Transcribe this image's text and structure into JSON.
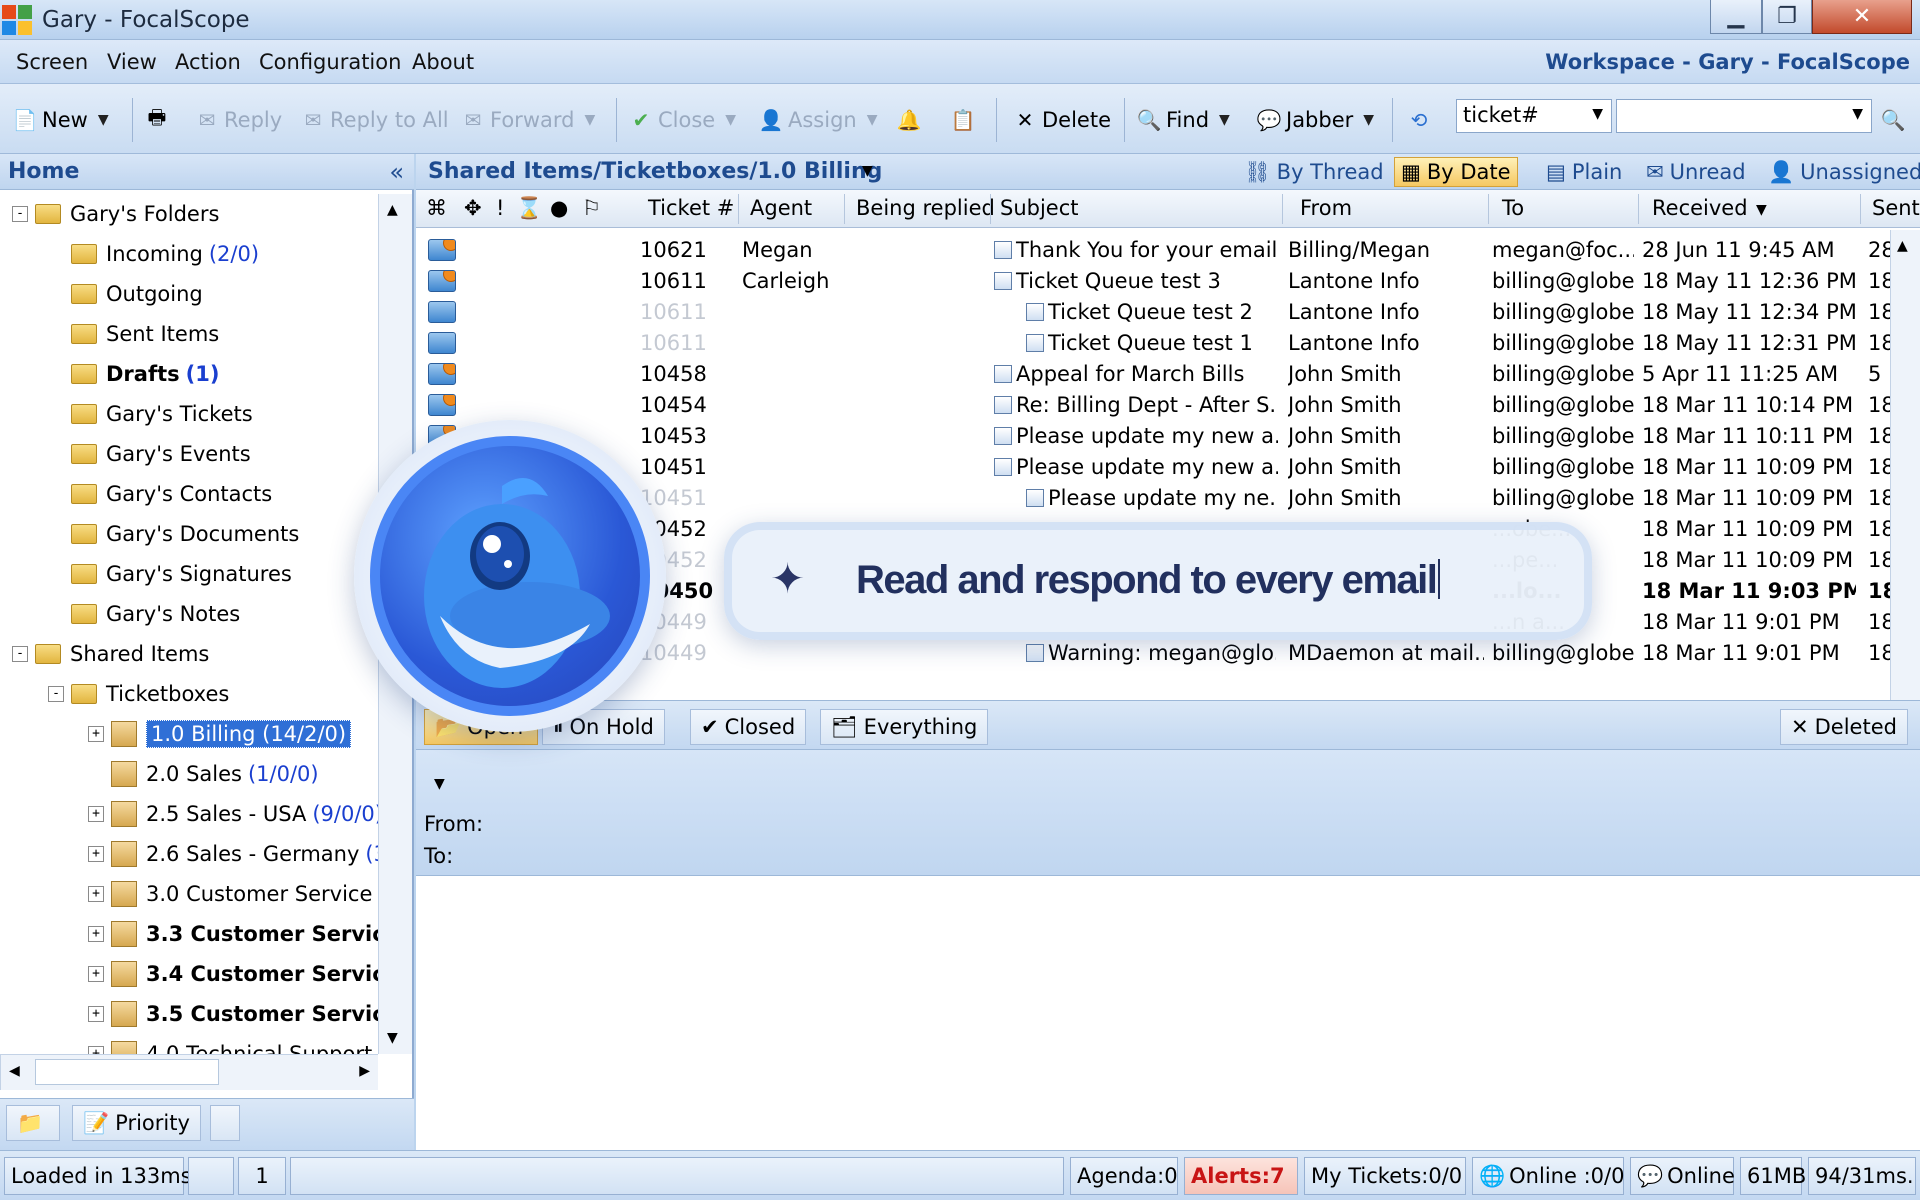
{
  "window": {
    "title": "Gary - FocalScope"
  },
  "menu": {
    "items": [
      "Screen",
      "View",
      "Action",
      "Configuration",
      "About"
    ],
    "workspace_title": "Workspace - Gary - FocalScope"
  },
  "toolbar": {
    "new": "New",
    "reply": "Reply",
    "reply_all": "Reply to All",
    "forward": "Forward",
    "close": "Close",
    "assign": "Assign",
    "delete": "Delete",
    "find": "Find",
    "jabber": "Jabber",
    "search_field": "ticket#",
    "search_value": ""
  },
  "left": {
    "header": "Home",
    "tree": [
      {
        "label": "Gary's Folders",
        "level": 0,
        "expander": "-"
      },
      {
        "label": "Incoming",
        "count": "(2/0)",
        "level": 1
      },
      {
        "label": "Outgoing",
        "level": 1
      },
      {
        "label": "Sent Items",
        "level": 1
      },
      {
        "label": "Drafts",
        "count": "(1)",
        "level": 1,
        "bold": true
      },
      {
        "label": "Gary's Tickets",
        "level": 1
      },
      {
        "label": "Gary's Events",
        "level": 1
      },
      {
        "label": "Gary's Contacts",
        "level": 1
      },
      {
        "label": "Gary's Documents",
        "level": 1
      },
      {
        "label": "Gary's Signatures",
        "level": 1
      },
      {
        "label": "Gary's Notes",
        "level": 1
      },
      {
        "label": "Shared Items",
        "level": 0,
        "expander": "-"
      },
      {
        "label": "Ticketboxes",
        "level": 1,
        "expander": "-"
      },
      {
        "label": "1.0 Billing (14/2/0)",
        "level": 2,
        "expander": "+",
        "selected": true
      },
      {
        "label": "2.0 Sales",
        "count": "(1/0/0)",
        "level": 2
      },
      {
        "label": "2.5 Sales - USA",
        "count": "(9/0/0)",
        "level": 2,
        "expander": "+"
      },
      {
        "label": "2.6 Sales - Germany",
        "count": "(3",
        "level": 2,
        "expander": "+"
      },
      {
        "label": "3.0 Customer Service",
        "level": 2,
        "expander": "+"
      },
      {
        "label": "3.3 Customer Servic",
        "level": 2,
        "expander": "+",
        "bold": true
      },
      {
        "label": "3.4 Customer Servic",
        "level": 2,
        "expander": "+",
        "bold": true
      },
      {
        "label": "3.5 Customer Servic",
        "level": 2,
        "expander": "+",
        "bold": true
      },
      {
        "label": "4.0 Technical Support",
        "level": 2,
        "expander": "+"
      }
    ],
    "bottom_tab": "Priority"
  },
  "grid": {
    "path": "Shared Items/Ticketboxes/1.0 Billing",
    "views": [
      "By Thread",
      "By Date",
      "Plain",
      "Unread",
      "Unassigned"
    ],
    "active_view": "By Date",
    "columns": [
      "Ticket #",
      "Agent",
      "Being replied",
      "Subject",
      "From",
      "To",
      "Received",
      "Sent"
    ],
    "rows": [
      {
        "ticket": "10621",
        "agent": "Megan",
        "subject": "Thank You for your email...",
        "from": "Billing/Megan",
        "to": "megan@foc...",
        "received": "28 Jun 11 9:45 AM",
        "sent": "28",
        "dim": false,
        "indent": false,
        "thread": false,
        "icon": "flag"
      },
      {
        "ticket": "10611",
        "agent": "Carleigh",
        "subject": "Ticket Queue test 3",
        "from": "Lantone Info",
        "to": "billing@globe...",
        "received": "18 May 11 12:36 PM",
        "sent": "18",
        "dim": false,
        "indent": false,
        "thread": true,
        "icon": "flag"
      },
      {
        "ticket": "10611",
        "agent": "",
        "subject": "Ticket Queue test 2",
        "from": "Lantone Info",
        "to": "billing@globe...",
        "received": "18 May 11 12:34 PM",
        "sent": "18",
        "dim": true,
        "indent": true,
        "thread": false,
        "icon": "plain"
      },
      {
        "ticket": "10611",
        "agent": "",
        "subject": "Ticket Queue test 1",
        "from": "Lantone Info",
        "to": "billing@globe...",
        "received": "18 May 11 12:31 PM",
        "sent": "18",
        "dim": true,
        "indent": true,
        "thread": false,
        "icon": "plain"
      },
      {
        "ticket": "10458",
        "agent": "",
        "subject": "Appeal for March Bills",
        "from": "John Smith",
        "to": "billing@globe...",
        "received": "5 Apr 11 11:25 AM",
        "sent": "5",
        "dim": false,
        "indent": false,
        "thread": false,
        "icon": "flag"
      },
      {
        "ticket": "10454",
        "agent": "",
        "subject": "Re: Billing Dept - After S...",
        "from": "John Smith",
        "to": "billing@globe...",
        "received": "18 Mar 11 10:14 PM",
        "sent": "18",
        "dim": false,
        "indent": false,
        "thread": false,
        "icon": "flag"
      },
      {
        "ticket": "10453",
        "agent": "",
        "subject": "Please update my new a...",
        "from": "John Smith",
        "to": "billing@globe...",
        "received": "18 Mar 11 10:11 PM",
        "sent": "18",
        "dim": false,
        "indent": false,
        "thread": false,
        "icon": "flag"
      },
      {
        "ticket": "10451",
        "agent": "",
        "subject": "Please update my new a...",
        "from": "John Smith",
        "to": "billing@globe...",
        "received": "18 Mar 11 10:09 PM",
        "sent": "18",
        "dim": false,
        "indent": false,
        "thread": true,
        "icon": "flag"
      },
      {
        "ticket": "10451",
        "agent": "",
        "subject": "Please update my ne...",
        "from": "John Smith",
        "to": "billing@globe...",
        "received": "18 Mar 11 10:09 PM",
        "sent": "18",
        "dim": true,
        "indent": true,
        "thread": false,
        "icon": "plain"
      },
      {
        "ticket": "10452",
        "agent": "",
        "subject": "",
        "from": "",
        "to": "...obe...",
        "received": "18 Mar 11 10:09 PM",
        "sent": "18",
        "dim": false,
        "indent": false,
        "thread": false,
        "icon": "flag"
      },
      {
        "ticket": "10452",
        "agent": "",
        "subject": "",
        "from": "",
        "to": "...pe...",
        "received": "18 Mar 11 10:09 PM",
        "sent": "18",
        "dim": true,
        "indent": false,
        "thread": false,
        "icon": "plain"
      },
      {
        "ticket": "10450",
        "agent": "",
        "subject": "",
        "from": "",
        "to": "...lo...",
        "received": "18 Mar 11 9:03 PM",
        "sent": "18",
        "dim": false,
        "bold": true,
        "indent": false,
        "thread": false,
        "icon": "flag"
      },
      {
        "ticket": "10449",
        "agent": "",
        "subject": "",
        "from": "",
        "to": "...n a...",
        "received": "18 Mar 11 9:01 PM",
        "sent": "18",
        "dim": true,
        "indent": false,
        "thread": false,
        "icon": "plain"
      },
      {
        "ticket": "10449",
        "agent": "",
        "subject": "Warning: megan@glo...",
        "from": "MDaemon at mail...",
        "to": "billing@globe...",
        "received": "18 Mar 11 9:01 PM",
        "sent": "18",
        "dim": true,
        "indent": true,
        "thread": false,
        "icon": "plain"
      }
    ]
  },
  "status_tabs": [
    "Open",
    "On Hold",
    "Closed",
    "Everything",
    "Deleted"
  ],
  "preview": {
    "from_label": "From:",
    "to_label": "To:"
  },
  "statusbar": {
    "loaded": "Loaded in 133ms.",
    "page": "1",
    "agenda": "Agenda:0",
    "alerts": "Alerts:7",
    "my_tickets": "My Tickets:0/0",
    "online_count": "Online :0/0",
    "online": "Online",
    "memory": "61MB",
    "timing": "94/31ms."
  },
  "overlay": {
    "prompt": "Read and respond to every email"
  },
  "colors": {
    "accent": "#1e4b8f",
    "selection": "#2f6fd6",
    "alert": "#c81414",
    "link_count": "#1a3fcf"
  }
}
